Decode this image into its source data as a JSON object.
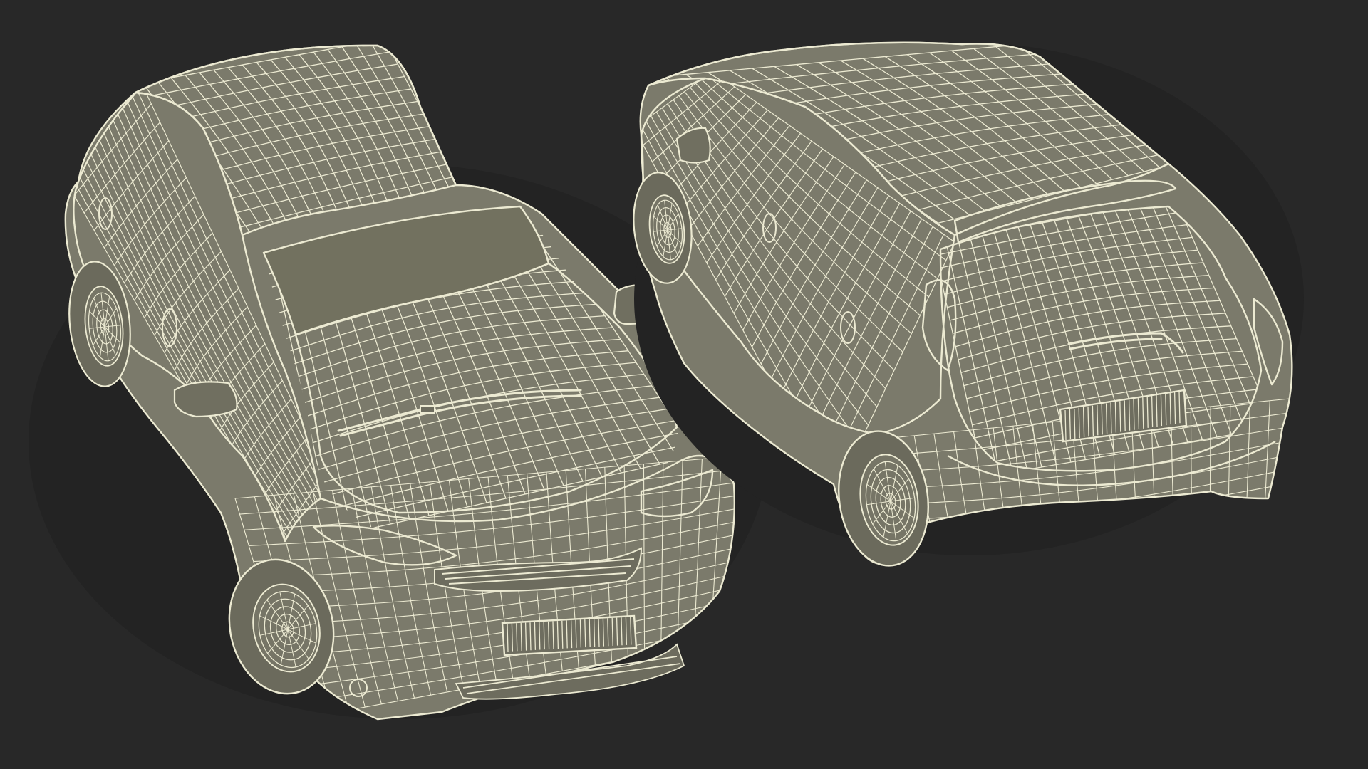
{
  "scene": {
    "kind": "3d-wireframe-render",
    "subject": "hatchback-car",
    "views": [
      "front-three-quarter",
      "rear-three-quarter"
    ]
  },
  "colors": {
    "background": "#282828",
    "body_fill": "#7b7a6b",
    "body_fill_dark": "#6a695c",
    "wire": "#ecead2",
    "wire_soft": "#d8d6bd",
    "shadow": "#1d1d1d"
  }
}
